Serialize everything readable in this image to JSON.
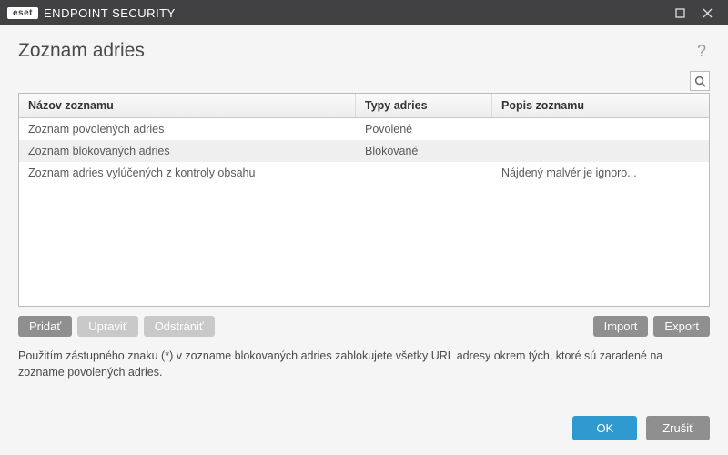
{
  "titlebar": {
    "brand_pill": "eset",
    "brand_text": "ENDPOINT SECURITY"
  },
  "header": {
    "title": "Zoznam adries",
    "help": "?"
  },
  "table": {
    "headers": {
      "name": "Názov zoznamu",
      "type": "Typy adries",
      "desc": "Popis zoznamu"
    },
    "rows": [
      {
        "name": "Zoznam povolených adries",
        "type": "Povolené",
        "desc": ""
      },
      {
        "name": "Zoznam blokovaných adries",
        "type": "Blokované",
        "desc": ""
      },
      {
        "name": "Zoznam adries vylúčených z kontroly obsahu",
        "type": "",
        "desc": "Nájdený malvér je ignoro..."
      }
    ]
  },
  "actions": {
    "add": "Pridať",
    "edit": "Upraviť",
    "remove": "Odstrániť",
    "import": "Import",
    "export": "Export"
  },
  "hint": "Použitím zástupného znaku (*) v zozname blokovaných adries zablokujete všetky URL adresy okrem tých, ktoré sú zaradené na zozname povolených adries.",
  "footer": {
    "ok": "OK",
    "cancel": "Zrušiť"
  }
}
